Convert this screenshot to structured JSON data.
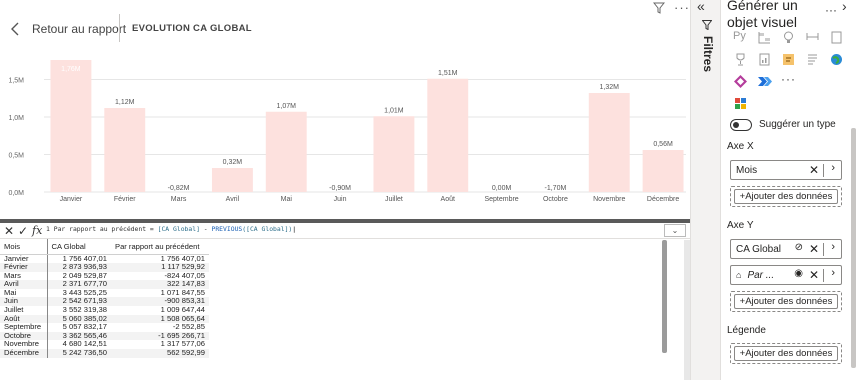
{
  "header": {
    "back_label": "Retour au rapport",
    "visual_title": "EVOLUTION CA GLOBAL"
  },
  "chart_data": {
    "type": "bar",
    "categories": [
      "Janvier",
      "Février",
      "Mars",
      "Avril",
      "Mai",
      "Juin",
      "Juillet",
      "Août",
      "Septembre",
      "Octobre",
      "Novembre",
      "Décembre"
    ],
    "values": [
      1.76,
      1.12,
      -0.82,
      0.32,
      1.07,
      -0.9,
      1.01,
      1.51,
      0.0,
      -1.7,
      1.32,
      0.56
    ],
    "data_labels": [
      "1,76M",
      "1,12M",
      "-0,82M",
      "0,32M",
      "1,07M",
      "-0,90M",
      "1,01M",
      "1,51M",
      "0,00M",
      "-1,70M",
      "1,32M",
      "0,56M"
    ],
    "y_ticks": [
      "0,0M",
      "0,5M",
      "1,0M",
      "1,5M"
    ],
    "y_tick_values": [
      0,
      0.5,
      1.0,
      1.5
    ],
    "ylim": [
      0,
      1.76
    ],
    "grid": true,
    "bar_color": "#fde1de",
    "title": "",
    "xlabel": "",
    "ylabel": ""
  },
  "formula": {
    "line_no": "1",
    "text_a": "Par rapport au précédent = ",
    "tbl_a": "[CA Global]",
    "text_b": " - ",
    "func": "PREVIOUS",
    "tbl_b": "([CA Global])"
  },
  "table": {
    "columns": [
      "Mois",
      "CA Global",
      "Par rapport au précédent"
    ],
    "rows": [
      [
        "Janvier",
        "1 756 407,01",
        "1 756 407,01"
      ],
      [
        "Février",
        "2 873 936,93",
        "1 117 529,92"
      ],
      [
        "Mars",
        "2 049 529,87",
        "-824 407,05"
      ],
      [
        "Avril",
        "2 371 677,70",
        "322 147,83"
      ],
      [
        "Mai",
        "3 443 525,25",
        "1 071 847,55"
      ],
      [
        "Juin",
        "2 542 671,93",
        "-900 853,31"
      ],
      [
        "Juillet",
        "3 552 319,38",
        "1 009 647,44"
      ],
      [
        "Août",
        "5 060 385,02",
        "1 508 065,64"
      ],
      [
        "Septembre",
        "5 057 832,17",
        "-2 552,85"
      ],
      [
        "Octobre",
        "3 362 565,46",
        "-1 695 266,71"
      ],
      [
        "Novembre",
        "4 680 142,51",
        "1 317 577,06"
      ],
      [
        "Décembre",
        "5 242 736,50",
        "562 592,99"
      ]
    ]
  },
  "filters_label": "Filtres",
  "viz_pane": {
    "title": "Générer un objet visuel",
    "toggle_label": "Suggérer un type",
    "axe_x": "Axe X",
    "axe_x_field": "Mois",
    "axe_y": "Axe Y",
    "axe_y_field1": "CA Global",
    "axe_y_field2": "Par ...",
    "legend": "Légende",
    "add_label": "+Ajouter des données"
  },
  "colors": {
    "accent": "#1a5fb4",
    "bar": "#fde1de"
  }
}
